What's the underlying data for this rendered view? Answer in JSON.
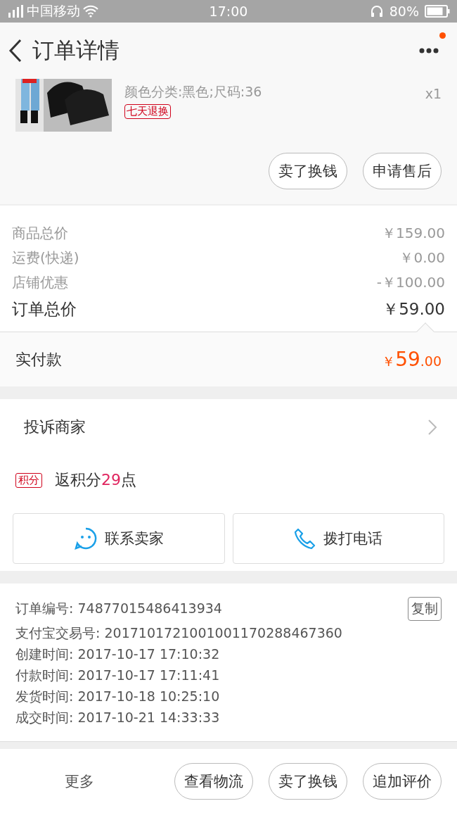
{
  "status_bar": {
    "carrier": "中国移动",
    "time": "17:00",
    "battery": "80%"
  },
  "header": {
    "title": "订单详情",
    "has_notification": true
  },
  "product": {
    "sku": "颜色分类:黑色;尺码:36",
    "tag": "七天退换",
    "quantity": "x1",
    "buttons": [
      "卖了换钱",
      "申请售后"
    ]
  },
  "prices": [
    {
      "label": "商品总价",
      "value": "￥159.00",
      "kind": "minor"
    },
    {
      "label": "运费(快递)",
      "value": "￥0.00",
      "kind": "minor"
    },
    {
      "label": "店铺优惠",
      "value": "-￥100.00",
      "kind": "minor"
    },
    {
      "label": "订单总价",
      "value": "￥59.00",
      "kind": "total"
    }
  ],
  "paid": {
    "label": "实付款",
    "currency": "￥",
    "integer": "59",
    "decimal": ".00"
  },
  "complaint": {
    "label": "投诉商家"
  },
  "points": {
    "badge": "积分",
    "prefix": "返积分",
    "amount": "29",
    "suffix": "点"
  },
  "contact": [
    {
      "label": "联系卖家",
      "kind": "chat"
    },
    {
      "label": "拨打电话",
      "kind": "phone"
    }
  ],
  "info": [
    {
      "label": "订单编号:",
      "value": "74877015486413934",
      "copy": "复制"
    },
    {
      "label": "支付宝交易号:",
      "value": "2017101721001001170288467360"
    },
    {
      "label": "创建时间:",
      "value": "2017-10-17 17:10:32"
    },
    {
      "label": "付款时间:",
      "value": "2017-10-17 17:11:41"
    },
    {
      "label": "发货时间:",
      "value": "2017-10-18 10:25:10"
    },
    {
      "label": "成交时间:",
      "value": "2017-10-21 14:33:33"
    }
  ],
  "bottom_bar": {
    "more": "更多",
    "buttons": [
      "查看物流",
      "卖了换钱",
      "追加评价"
    ]
  }
}
